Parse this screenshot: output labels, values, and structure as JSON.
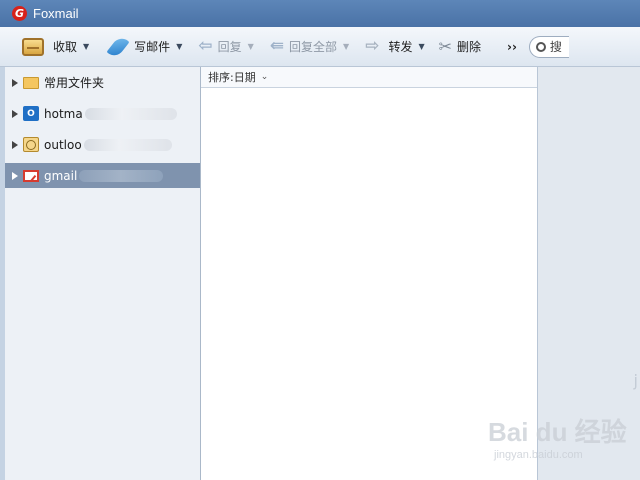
{
  "window": {
    "title": "Foxmail"
  },
  "toolbar": {
    "receive": {
      "label": "收取",
      "icon": "inbox-icon"
    },
    "compose": {
      "label": "写邮件",
      "icon": "feather-pen-icon"
    },
    "reply": {
      "label": "回复",
      "icon": "reply-arrow-icon"
    },
    "reply_all": {
      "label": "回复全部",
      "icon": "reply-all-arrow-icon"
    },
    "forward": {
      "label": "转发",
      "icon": "forward-arrow-icon"
    },
    "delete": {
      "label": "删除",
      "icon": "scissors-icon"
    },
    "more": {
      "label": "››"
    },
    "search": {
      "text": "搜"
    }
  },
  "sidebar": {
    "items": [
      {
        "label": "常用文件夹",
        "icon": "folder-icon",
        "selected": false
      },
      {
        "label": "hotma",
        "icon": "outlook-icon",
        "selected": false
      },
      {
        "label": "outloo",
        "icon": "calendar-icon",
        "selected": false
      },
      {
        "label": "gmail",
        "icon": "gmail-icon",
        "selected": true
      }
    ]
  },
  "message_list": {
    "sort_label": "排序:日期"
  },
  "watermark": {
    "main": "Bai du 经验",
    "sub": "jingyan.baidu.com"
  },
  "colors": {
    "titlebar": "#4a72a6",
    "selected_row": "#7f93ae",
    "brand_red": "#d8221a"
  }
}
